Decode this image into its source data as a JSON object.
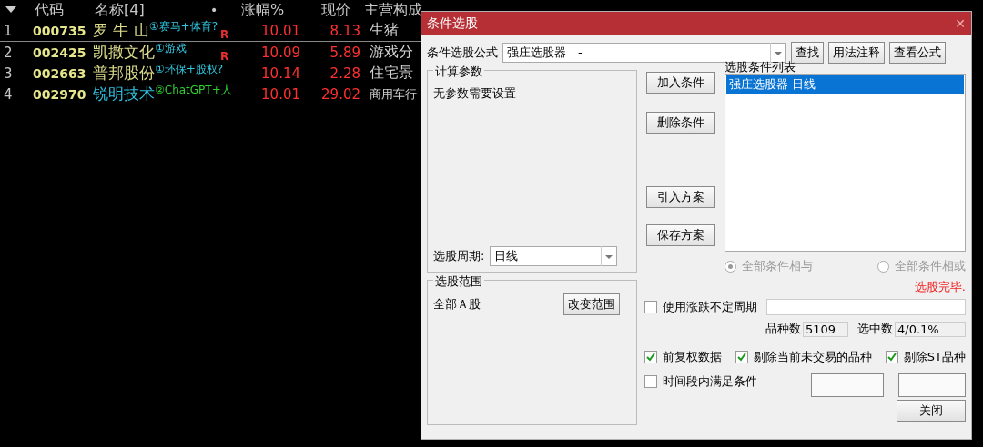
{
  "table": {
    "headers": [
      "代码",
      "名称[4]",
      "•",
      "涨幅%",
      "现价",
      "主营构成"
    ],
    "rows": [
      {
        "index": "1",
        "code": "000735",
        "name": "罗 牛 山",
        "color": "#dcdc8c",
        "tag": {
          "text": "①赛马+体育?",
          "color": "#30c8e0"
        },
        "flag": "R",
        "change": "10.01",
        "price": "8.13",
        "business": "生猪",
        "selected": true
      },
      {
        "index": "2",
        "code": "002425",
        "name": "凯撒文化",
        "color": "#dcdc8c",
        "tag": {
          "text": "①游戏",
          "color": "#30c8e0"
        },
        "flag": "R",
        "change": "10.09",
        "price": "5.89",
        "business": "游戏分",
        "selected": false
      },
      {
        "index": "3",
        "code": "002663",
        "name": "普邦股份",
        "color": "#dcdc8c",
        "tag": {
          "text": "①环保+股权?",
          "color": "#30c8e0"
        },
        "change": "10.14",
        "price": "2.28",
        "business": "住宅景",
        "selected": false
      },
      {
        "index": "4",
        "code": "002970",
        "name": "锐明技术",
        "color": "#30c0e0",
        "tag": {
          "text": "②ChatGPT+人",
          "color": "#30d030"
        },
        "change": "10.01",
        "price": "29.02",
        "business": "商用车行",
        "selected": false
      }
    ]
  },
  "dialog": {
    "title": "条件选股",
    "minimize": "—",
    "close": "✕",
    "formula_label": "条件选股公式",
    "formula_value": "强庄选股器　-",
    "top_buttons": [
      "查找",
      "用法注释",
      "查看公式"
    ],
    "params_group": "计算参数",
    "params_text": "无参数需要设置",
    "period_label": "选股周期:",
    "period_value": "日线",
    "range_group": "选股范围",
    "range_text": "全部Ａ股",
    "range_button": "改变范围",
    "middle_buttons": [
      "加入条件",
      "删除条件",
      "引入方案",
      "保存方案"
    ],
    "list_label": "选股条件列表",
    "list_items": [
      {
        "text": "强庄选股器  日线",
        "selected": true
      }
    ],
    "radios": [
      {
        "label": "全部条件相与",
        "selected": true
      },
      {
        "label": "全部条件相或",
        "selected": false
      }
    ],
    "status": "选股完毕.",
    "variable_period": {
      "label": "使用涨跌不定周期",
      "checked": false
    },
    "count_label": "品种数",
    "count_value": "5109",
    "selected_label": "选中数",
    "selected_value": "4/0.1%",
    "options": [
      {
        "label": "前复权数据",
        "checked": true
      },
      {
        "label": "剔除当前未交易的品种",
        "checked": true
      },
      {
        "label": "剔除ST品种",
        "checked": true
      }
    ],
    "time_range": {
      "label": "时间段内满足条件",
      "checked": false
    },
    "close_button": "关闭"
  }
}
